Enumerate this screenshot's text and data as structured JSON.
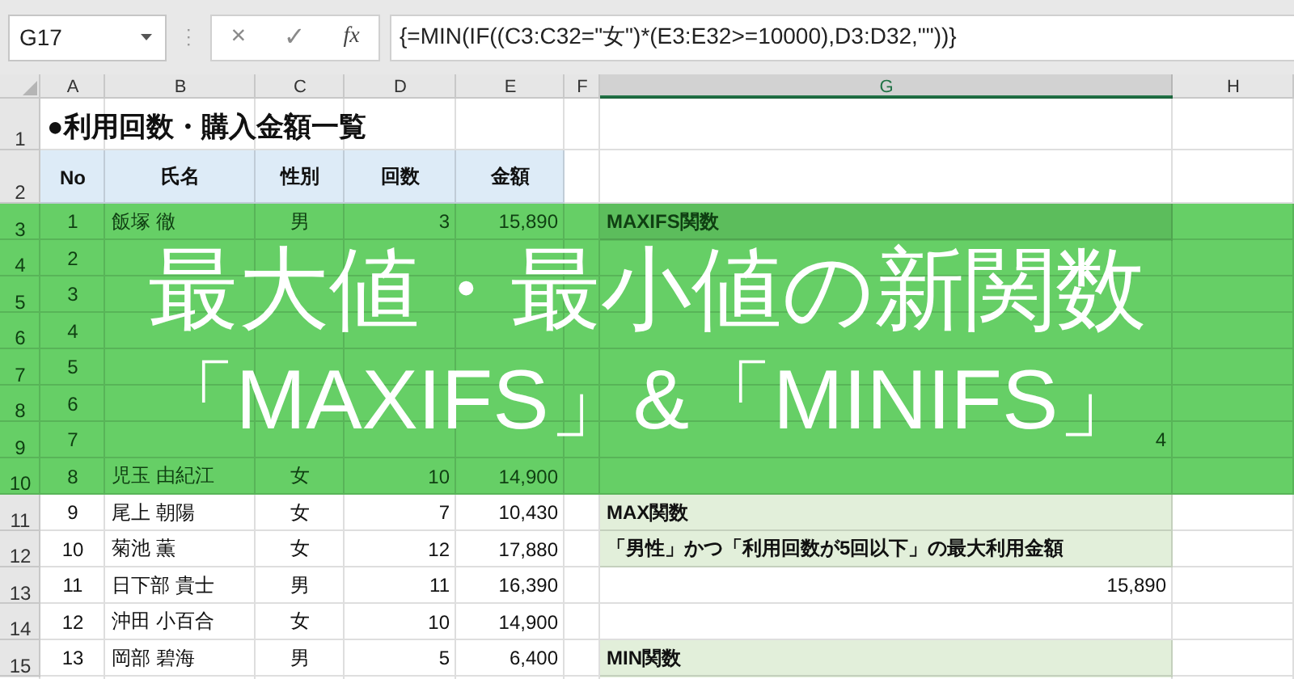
{
  "formula_bar": {
    "name_box": "G17",
    "cancel_icon": "×",
    "enter_icon": "✓",
    "function_icon": "fx",
    "formula": "{=MIN(IF((C3:C32=\"女\")*(E3:E32>=10000),D3:D32,\"\"))}"
  },
  "sheet": {
    "columns": [
      {
        "label": "A",
        "selected": false
      },
      {
        "label": "B",
        "selected": false
      },
      {
        "label": "C",
        "selected": false
      },
      {
        "label": "D",
        "selected": false
      },
      {
        "label": "E",
        "selected": false
      },
      {
        "label": "F",
        "selected": false
      },
      {
        "label": "G",
        "selected": true
      },
      {
        "label": "H",
        "selected": false
      }
    ],
    "title_row": {
      "number": "1",
      "title": "●利用回数・購入金額一覧"
    },
    "header_row": {
      "number": "2",
      "labels": [
        "No",
        "氏名",
        "性別",
        "回数",
        "金額"
      ]
    },
    "rows": [
      {
        "number": "3",
        "no": "1",
        "name": "飯塚 徹",
        "gender": "男",
        "count": "3",
        "amount": "15,890",
        "g": {
          "kind": "label",
          "text": "MAXIFS関数"
        }
      },
      {
        "number": "4",
        "no": "2"
      },
      {
        "number": "5",
        "no": "3"
      },
      {
        "number": "6",
        "no": "4"
      },
      {
        "number": "7",
        "no": "5"
      },
      {
        "number": "8",
        "no": "6"
      },
      {
        "number": "9",
        "no": "7",
        "g": {
          "kind": "value",
          "text": "4"
        }
      },
      {
        "number": "10",
        "no": "8",
        "name": "児玉 由紀江",
        "gender": "女",
        "count": "10",
        "amount": "14,900"
      },
      {
        "number": "11",
        "no": "9",
        "name": "尾上 朝陽",
        "gender": "女",
        "count": "7",
        "amount": "10,430",
        "g": {
          "kind": "label",
          "text": "MAX関数"
        }
      },
      {
        "number": "12",
        "no": "10",
        "name": "菊池 薫",
        "gender": "女",
        "count": "12",
        "amount": "17,880",
        "g": {
          "kind": "label",
          "text": "「男性」かつ「利用回数が5回以下」の最大利用金額"
        }
      },
      {
        "number": "13",
        "no": "11",
        "name": "日下部 貴士",
        "gender": "男",
        "count": "11",
        "amount": "16,390",
        "g": {
          "kind": "value",
          "text": "15,890"
        }
      },
      {
        "number": "14",
        "no": "12",
        "name": "沖田 小百合",
        "gender": "女",
        "count": "10",
        "amount": "14,900"
      },
      {
        "number": "15",
        "no": "13",
        "name": "岡部 碧海",
        "gender": "男",
        "count": "5",
        "amount": "6,400",
        "g": {
          "kind": "label",
          "text": "MIN関数"
        }
      }
    ]
  },
  "banner": {
    "lines": [
      "最大値・最小値の新関数",
      "「MAXIFS」&「MINIFS」"
    ]
  }
}
